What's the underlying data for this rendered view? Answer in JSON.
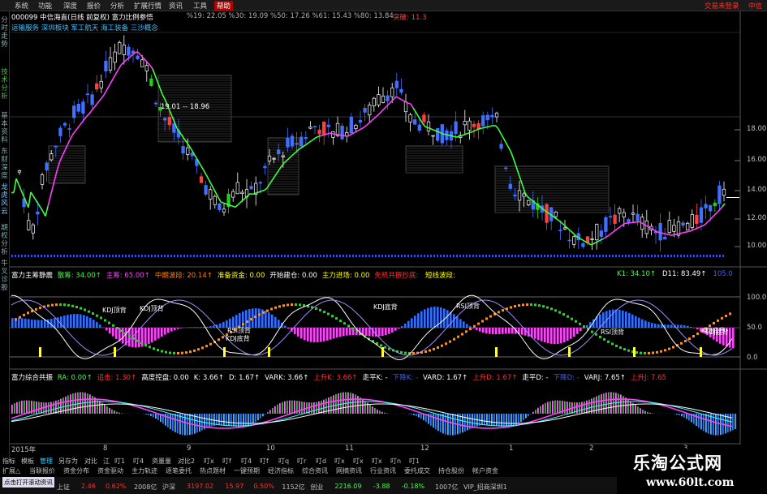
{
  "menu": {
    "items": [
      "系统",
      "功能",
      "深度",
      "报价",
      "分析",
      "扩展行情",
      "资讯",
      "工具",
      "帮助"
    ],
    "active_index": 8,
    "right": [
      "交易未登录",
      "中信"
    ]
  },
  "chart_header": {
    "code_name": "000099 中信海直(日线 前复权) 富力比例参悟",
    "ma_values": "%19: 22.05 %30: 19.09 %50: 17.26 %61: 15.43 %80: 13.84",
    "breakout": "突破: 11.3",
    "sub_concepts": "运输服务 深圳板块 军工航天 海工装备 三沙概念",
    "box_label": "19.01 -- 18.96"
  },
  "left_tabs": [
    {
      "text": "分时走势",
      "color": "normal"
    },
    {
      "text": "技术分析",
      "color": "green"
    },
    {
      "text": "基本资料",
      "color": "normal"
    },
    {
      "text": "东财深度",
      "color": "normal"
    },
    {
      "text": "龙虎风云",
      "color": "blue"
    },
    {
      "text": "期权分析",
      "color": "normal"
    },
    {
      "text": "牛叉诊股",
      "color": "normal"
    }
  ],
  "price_axis": {
    "ymin": 9.5,
    "ymax": 19.0,
    "ticks": [
      "18.00",
      "16.00",
      "14.00",
      "12.00",
      "10.00"
    ]
  },
  "panel2": {
    "name": "富力主筹静震",
    "items": [
      {
        "label": "散筹:",
        "value": "34.00↑",
        "color": "#40ff40"
      },
      {
        "label": "主筹:",
        "value": "65.00↑",
        "color": "#ff40ff"
      },
      {
        "label": "中期波段:",
        "value": "20.14↑",
        "color": "#ff8000"
      },
      {
        "label": "准备资金:",
        "value": "0.00",
        "color": "#ffff00"
      },
      {
        "label": "开始建仓:",
        "value": "0.00",
        "color": "#ffffff"
      },
      {
        "label": "主力进场:",
        "value": "0.00",
        "color": "#ffff00"
      },
      {
        "label": "先机共振抄底:",
        "value": "",
        "color": "#ff3030"
      },
      {
        "label": "短线波段:",
        "value": "",
        "color": "#ffff00"
      }
    ],
    "right": [
      {
        "label": "K1:",
        "value": "34.10↑",
        "color": "#40ff40"
      },
      {
        "label": "D11:",
        "value": "83.49↑",
        "color": "#ffffff"
      },
      {
        "label": "",
        "value": "105.0",
        "color": "#4060ff"
      }
    ],
    "axis": [
      "100.0",
      "50.0",
      "0.0"
    ],
    "annotations": [
      "KDJ顶背",
      "KDJ顶背",
      "RSI顶背",
      "KDJ底背",
      "KDJ底背",
      "RSI顶背",
      "RSI顶背",
      "KDJ底背",
      "KDJ底背"
    ]
  },
  "panel3": {
    "name": "富力综合共振",
    "items": [
      {
        "label": "RA:",
        "value": "0.00↑",
        "color": "#40ff40"
      },
      {
        "label": "追击:",
        "value": "1.30↑",
        "color": "#ff3030"
      },
      {
        "label": "高度控盘:",
        "value": "0.00",
        "color": "#ffffff"
      },
      {
        "label": "K:",
        "value": "3.66↑",
        "color": "#ffffff"
      },
      {
        "label": "D:",
        "value": "1.67↑",
        "color": "#ffffff"
      },
      {
        "label": "VARK:",
        "value": "3.66↑",
        "color": "#ffffff"
      },
      {
        "label": "上升K:",
        "value": "3.66↑",
        "color": "#ff3030"
      },
      {
        "label": "走平K:",
        "value": "-",
        "color": "#ffffff"
      },
      {
        "label": "下降K:",
        "value": "-",
        "color": "#4060ff"
      },
      {
        "label": "VARD:",
        "value": "1.67↑",
        "color": "#ffffff"
      },
      {
        "label": "上升D:",
        "value": "1.67↑",
        "color": "#ff3030"
      },
      {
        "label": "走平D:",
        "value": "-",
        "color": "#ffffff"
      },
      {
        "label": "下降D:",
        "value": "-",
        "color": "#4060ff"
      },
      {
        "label": "VARJ:",
        "value": "7.65↑",
        "color": "#ffffff"
      },
      {
        "label": "上升J:",
        "value": "7.65",
        "color": "#ff3030"
      }
    ]
  },
  "date_axis": [
    "2015年",
    "8",
    "9",
    "10",
    "11",
    "12",
    "1",
    "2",
    "3"
  ],
  "bottom_tabs": [
    "指标",
    "模板",
    "管理",
    "另存为",
    "对比",
    "江",
    "叮1",
    "叮4",
    "资量量",
    "对比2",
    "叮x",
    "叮f",
    "叮4",
    "叮f",
    "叮q",
    "叮r",
    "叮d",
    "叮x",
    "叮x",
    "叮x",
    "叮n",
    "叮1"
  ],
  "bottom_tab_selected": 2,
  "func_bar": [
    "扩展△",
    "当联报价",
    "资金分布",
    "资金驱动",
    "主力轨迹",
    "逐笔委托",
    "热点题材",
    "一键预期",
    "经济指标",
    "综合资讯",
    "网摘资讯",
    "行业资讯",
    "委托成交",
    "持仓股份",
    "帐户资金"
  ],
  "status": [
    {
      "text": "上证",
      "color": "#c0c0c0"
    },
    {
      "text": "2.46",
      "color": "#ff3030"
    },
    {
      "text": "0.62%",
      "color": "#ff3030"
    },
    {
      "text": "2008亿",
      "color": "#c0c0c0"
    },
    {
      "text": "沪深",
      "color": "#c0c0c0"
    },
    {
      "text": "3197.02",
      "color": "#ff3030"
    },
    {
      "text": "15.97",
      "color": "#ff3030"
    },
    {
      "text": "0.50%",
      "color": "#ff3030"
    },
    {
      "text": "1152亿",
      "color": "#c0c0c0"
    },
    {
      "text": "创业",
      "color": "#c0c0c0"
    },
    {
      "text": "2216.09",
      "color": "#40ff40"
    },
    {
      "text": "-3.88",
      "color": "#40ff40"
    },
    {
      "text": "-0.18%",
      "color": "#40ff40"
    },
    {
      "text": "1007亿",
      "color": "#c0c0c0"
    },
    {
      "text": "VIP_招商深圳1",
      "color": "#c0c0c0"
    }
  ],
  "tooltip": "点击打开滚动资讯",
  "logo": {
    "title": "乐淘公式网",
    "url": "www.60lt.com"
  }
}
